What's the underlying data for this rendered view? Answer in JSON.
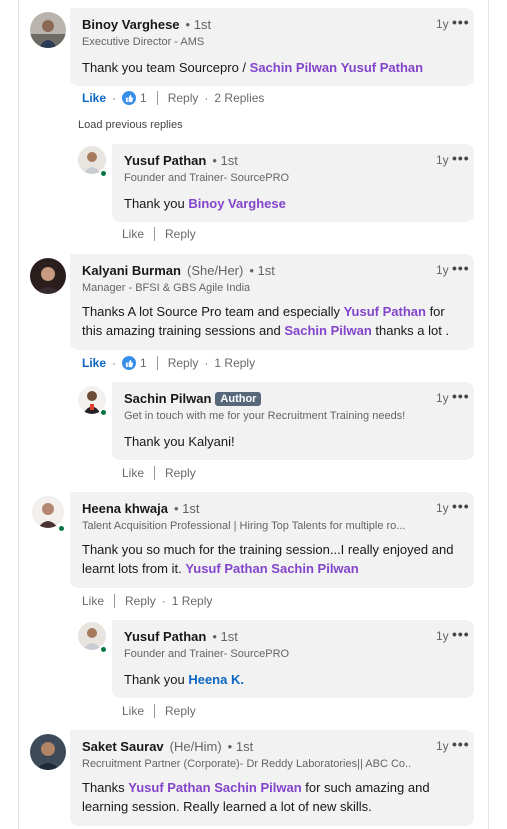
{
  "comments": [
    {
      "name": "Binoy Varghese",
      "pronouns": "",
      "degree": "• 1st",
      "headline": "Executive Director - AMS",
      "time": "1y",
      "text_prefix": "Thank you team Sourcepro / ",
      "mentions": [
        "Sachin Pilwan",
        "Yusuf Pathan"
      ],
      "actions": {
        "like": "Like",
        "reactions": "1",
        "reply": "Reply",
        "replies": "2 Replies"
      }
    },
    {
      "name": "Kalyani Burman",
      "pronouns": "(She/Her)",
      "degree": "• 1st",
      "headline": "Manager - BFSI & GBS Agile India",
      "time": "1y",
      "text_line1_a": "Thanks A lot Source Pro team and especially ",
      "mention1": "Yusuf Pathan",
      "text_line1_b": " for",
      "text_line2_a": "this amazing training sessions and ",
      "mention2": "Sachin Pilwan",
      "text_line2_b": " thanks a lot .",
      "actions": {
        "like": "Like",
        "reactions": "1",
        "reply": "Reply",
        "replies": "1 Reply"
      }
    },
    {
      "name": "Heena khwaja",
      "pronouns": "",
      "degree": "• 1st",
      "headline": "Talent Acquisition Professional | Hiring Top Talents for multiple ro...",
      "time": "1y",
      "text_line1": "Thank you so much for the training session...I really enjoyed and",
      "text_line2_a": "learnt lots from it. ",
      "mentions": [
        "Yusuf Pathan",
        "Sachin Pilwan"
      ],
      "actions": {
        "like": "Like",
        "reply": "Reply",
        "replies": "1 Reply"
      }
    },
    {
      "name": "Saket Saurav",
      "pronouns": "(He/Him)",
      "degree": "• 1st",
      "headline": "Recruitment Partner (Corporate)- Dr Reddy Laboratories|| ABC Co...",
      "time": "1y",
      "text_line1_a": "Thanks ",
      "mentions": [
        "Yusuf Pathan",
        "Sachin Pilwan"
      ],
      "text_line1_b": " for such amazing and",
      "text_line2": "learning session. Really learned a lot of new skills."
    }
  ],
  "replies": [
    {
      "name": "Yusuf Pathan",
      "degree": "• 1st",
      "headline": "Founder and Trainer- SourcePRO",
      "time": "1y",
      "text_prefix": "Thank you ",
      "mention": "Binoy Varghese",
      "actions": {
        "like": "Like",
        "reply": "Reply"
      }
    },
    {
      "name": "Sachin Pilwan",
      "badge": "Author",
      "headline": "Get in touch with me for your Recruitment Training needs!",
      "time": "1y",
      "text": "Thank you Kalyani!",
      "actions": {
        "like": "Like",
        "reply": "Reply"
      }
    },
    {
      "name": "Yusuf Pathan",
      "degree": "• 1st",
      "headline": "Founder and Trainer- SourcePRO",
      "time": "1y",
      "text_prefix": "Thank you ",
      "mention": "Heena K.",
      "actions": {
        "like": "Like",
        "reply": "Reply"
      }
    }
  ],
  "load_previous": "Load previous replies",
  "more_icon": "•••",
  "colors": {
    "mention": "#8344cc",
    "link": "#0a66c2",
    "bubble": "#f2f2f2",
    "presence": "#057642",
    "badge": "#56687a"
  }
}
